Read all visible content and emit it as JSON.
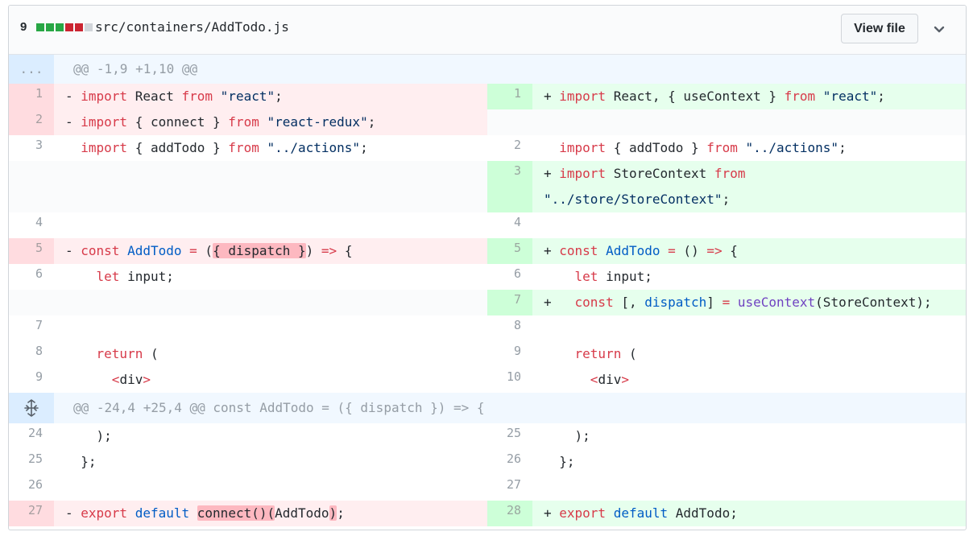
{
  "file": {
    "change_count": "9",
    "path": "src/containers/AddTodo.js",
    "view_file_label": "View file",
    "stat_blocks": [
      "#28a745",
      "#28a745",
      "#28a745",
      "#cb2431",
      "#cb2431",
      "#d1d5da"
    ]
  },
  "hunks": [
    {
      "gutter": "...",
      "header": "@@ -1,9 +1,10 @@"
    },
    {
      "gutter": "expand-icon",
      "header": "@@ -24,4 +25,4 @@ const AddTodo = ({ dispatch }) => {"
    }
  ],
  "rows": {
    "r1": {
      "l": {
        "n": "1",
        "t": "- import React from \"react\";"
      },
      "r": {
        "n": "1",
        "t": "+ import React, { useContext } from \"react\";"
      }
    },
    "r2": {
      "l": {
        "n": "2",
        "t": "- import { connect } from \"react-redux\";"
      }
    },
    "r3": {
      "l": {
        "n": "3",
        "t": "  import { addTodo } from \"../actions\";"
      },
      "r": {
        "n": "2",
        "t": "  import { addTodo } from \"../actions\";"
      }
    },
    "r4": {
      "r": {
        "n": "3",
        "t1": "+ import StoreContext from",
        "t2": "\"../store/StoreContext\";"
      }
    },
    "r5": {
      "l": {
        "n": "4"
      },
      "r": {
        "n": "4"
      }
    },
    "r6": {
      "l": {
        "n": "5",
        "t": "- const AddTodo = ({ dispatch }) => {"
      },
      "r": {
        "n": "5",
        "t": "+ const AddTodo = () => {"
      }
    },
    "r7": {
      "l": {
        "n": "6",
        "t": "    let input;"
      },
      "r": {
        "n": "6",
        "t": "    let input;"
      }
    },
    "r8": {
      "r": {
        "n": "7",
        "t": "+   const [, dispatch] = useContext(StoreContext);"
      }
    },
    "r9": {
      "l": {
        "n": "7"
      },
      "r": {
        "n": "8"
      }
    },
    "r10": {
      "l": {
        "n": "8",
        "t": "    return ("
      },
      "r": {
        "n": "9",
        "t": "    return ("
      }
    },
    "r11": {
      "l": {
        "n": "9",
        "t": "      <div>"
      },
      "r": {
        "n": "10",
        "t": "      <div>"
      }
    },
    "r12": {
      "l": {
        "n": "24",
        "t": "    );"
      },
      "r": {
        "n": "25",
        "t": "    );"
      }
    },
    "r13": {
      "l": {
        "n": "25",
        "t": "  };"
      },
      "r": {
        "n": "26",
        "t": "  };"
      }
    },
    "r14": {
      "l": {
        "n": "26"
      },
      "r": {
        "n": "27"
      }
    },
    "r15": {
      "l": {
        "n": "27",
        "t": "- export default connect()(AddTodo);"
      },
      "r": {
        "n": "28",
        "t": "+ export default AddTodo;"
      }
    }
  }
}
